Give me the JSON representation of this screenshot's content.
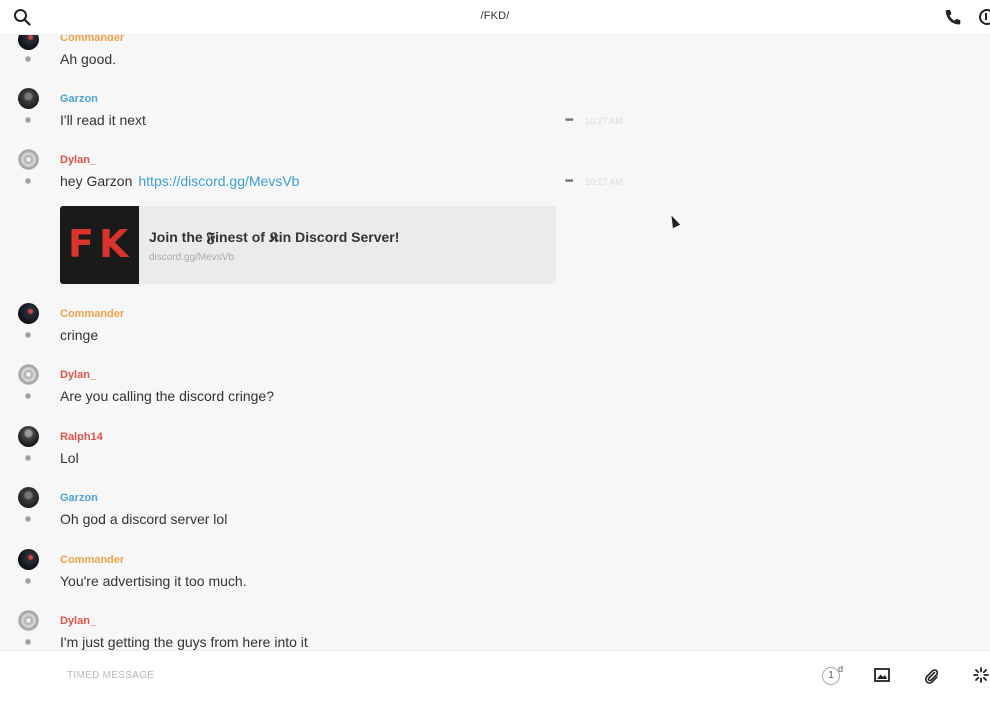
{
  "header": {
    "title": "/FKD/"
  },
  "messages": [
    {
      "user": "Commander",
      "text": "Ah good."
    },
    {
      "user": "Garzon",
      "text": "I'll read it next",
      "actions": "•••",
      "time": "10:27 AM"
    },
    {
      "user": "Dylan_",
      "text": "hey Garzon",
      "link": "https://discord.gg/MevsVb",
      "actions": "•••",
      "time": "10:27 AM"
    },
    {
      "user": "Commander",
      "text": "cringe"
    },
    {
      "user": "Dylan_",
      "text": "Are you calling the discord cringe?"
    },
    {
      "user": "Ralph14",
      "text": "Lol"
    },
    {
      "user": "Garzon",
      "text": "Oh god a discord server lol"
    },
    {
      "user": "Commander",
      "text": "You're advertising it too much."
    },
    {
      "user": "Dylan_",
      "text": "I'm just getting the guys from here into it"
    }
  ],
  "embed": {
    "thumb_f": "F",
    "thumb_k": "K",
    "title": "Join the 𝕱inest of 𝕶in Discord Server!",
    "url": "discord.gg/MevsVb"
  },
  "composer": {
    "placeholder": "TIMED MESSAGE",
    "timer_value": "1",
    "timer_unit": "d"
  },
  "colors": {
    "commander": "#f0a24a",
    "garzon": "#4ea3d7",
    "dylan": "#e0544a",
    "ralph": "#e0544a",
    "link": "#3a9fd6"
  },
  "icons": [
    "search-icon",
    "phone-icon",
    "info-icon",
    "image-icon",
    "attachment-icon",
    "sparkle-icon",
    "timer-icon"
  ]
}
